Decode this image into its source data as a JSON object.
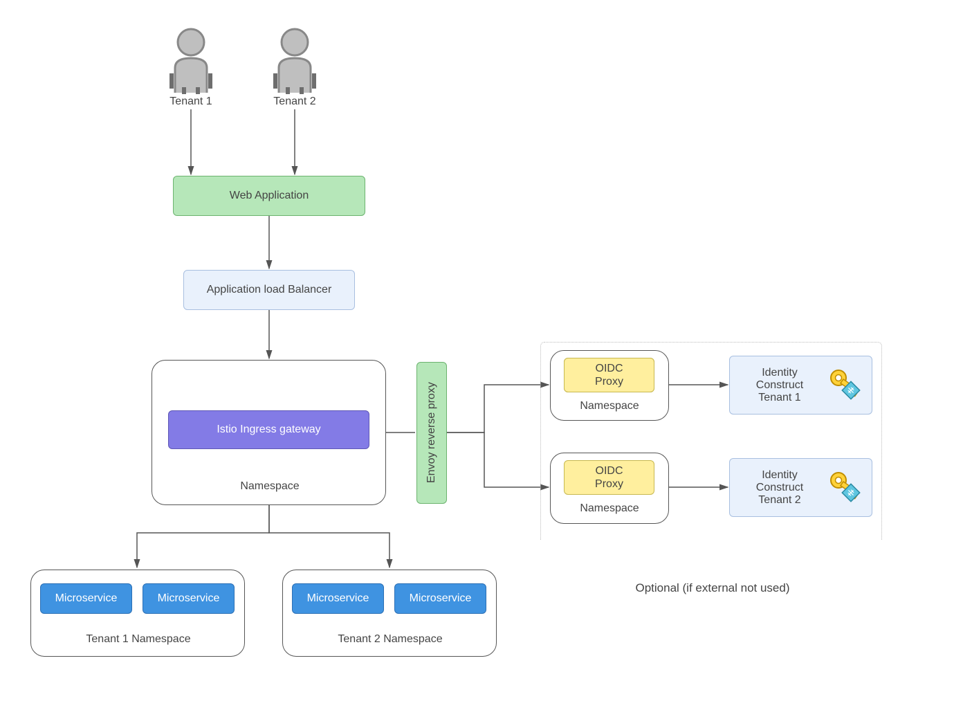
{
  "tenants": {
    "t1": "Tenant 1",
    "t2": "Tenant 2"
  },
  "web_app": "Web Application",
  "alb": "Application load Balancer",
  "istio_ns": {
    "gateway": "Istio Ingress gateway",
    "label": "Namespace"
  },
  "envoy": "Envoy reverse proxy",
  "oidc": {
    "proxy": "OIDC Proxy",
    "ns": "Namespace"
  },
  "identity": {
    "t1_l1": "Identity",
    "t1_l2": "Construct",
    "t1_l3": "Tenant 1",
    "t2_l1": "Identity",
    "t2_l2": "Construct",
    "t2_l3": "Tenant 2"
  },
  "micro": "Microservice",
  "tenant_ns": {
    "t1": "Tenant 1 Namespace",
    "t2": "Tenant 2 Namespace"
  },
  "optional": "Optional (if external not used)"
}
